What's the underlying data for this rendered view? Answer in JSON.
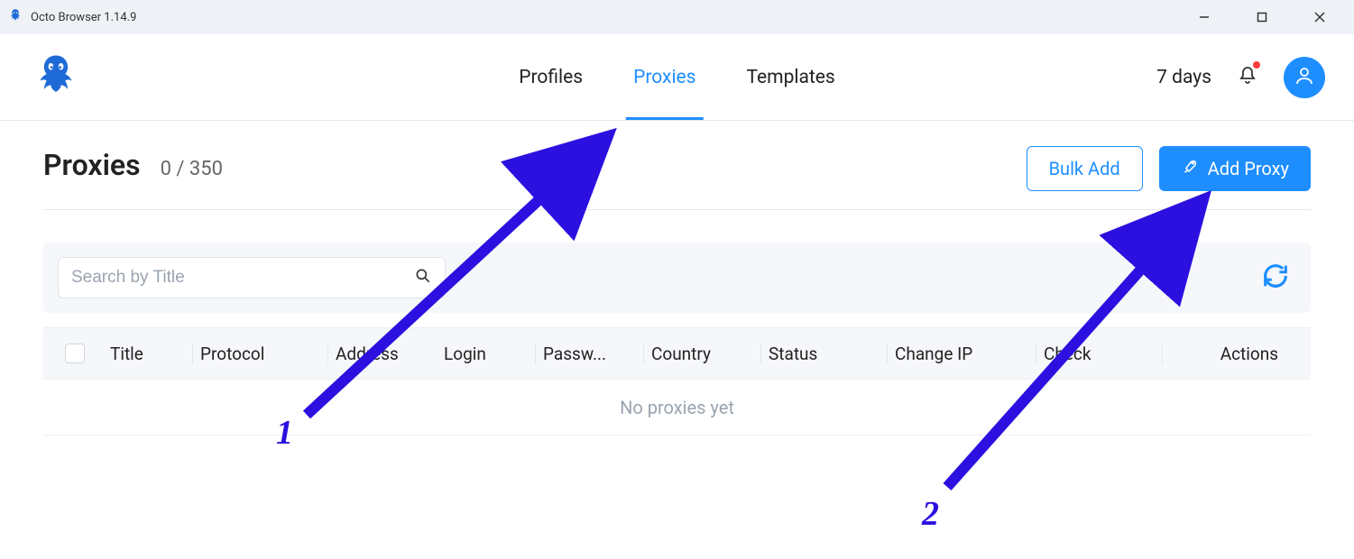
{
  "window": {
    "title": "Octo Browser 1.14.9"
  },
  "nav": {
    "tabs": [
      "Profiles",
      "Proxies",
      "Templates"
    ],
    "activeIndex": 1,
    "daysLabel": "7 days"
  },
  "page": {
    "title": "Proxies",
    "count": "0 / 350",
    "bulkAddLabel": "Bulk Add",
    "addProxyLabel": "Add Proxy"
  },
  "search": {
    "placeholder": "Search by Title"
  },
  "table": {
    "columns": {
      "title": "Title",
      "protocol": "Protocol",
      "address": "Address",
      "login": "Login",
      "password": "Passw...",
      "country": "Country",
      "status": "Status",
      "changeIP": "Change IP",
      "check": "Check",
      "actions": "Actions"
    },
    "emptyText": "No proxies yet"
  },
  "annotations": {
    "arrow1Label": "1",
    "arrow2Label": "2"
  },
  "colors": {
    "accent": "#1e8eff",
    "arrow": "#2b10e0"
  }
}
